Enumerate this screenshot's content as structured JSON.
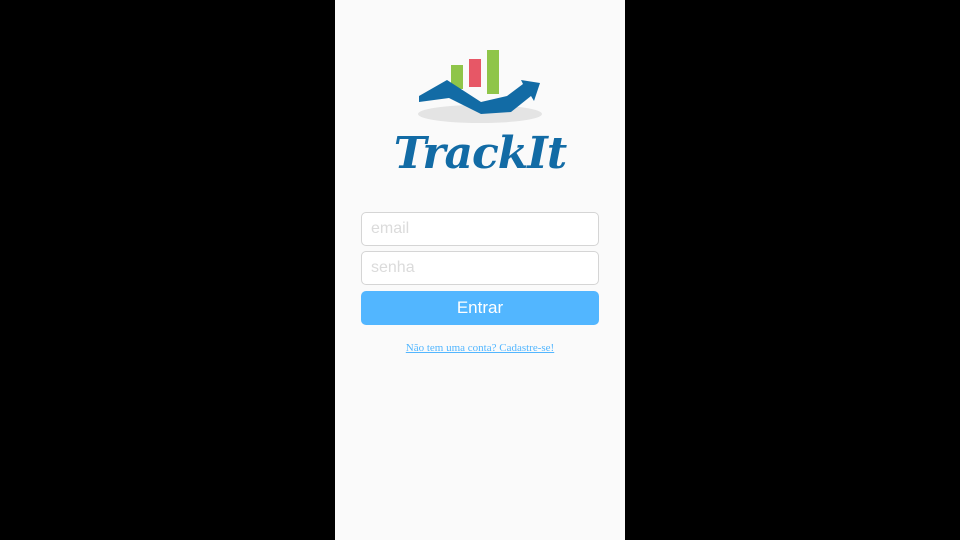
{
  "brand": {
    "name": "TrackIt",
    "colors": {
      "primary_blue": "#126ba5",
      "accent_blue": "#52b6ff",
      "bar_green": "#8fc549",
      "bar_red": "#e75766",
      "shadow": "#dadada"
    },
    "logo_icon": "rising-chart-icon"
  },
  "login": {
    "email_placeholder": "email",
    "password_placeholder": "senha",
    "submit_label": "Entrar",
    "signup_link": "Não tem uma conta? Cadastre-se!"
  }
}
